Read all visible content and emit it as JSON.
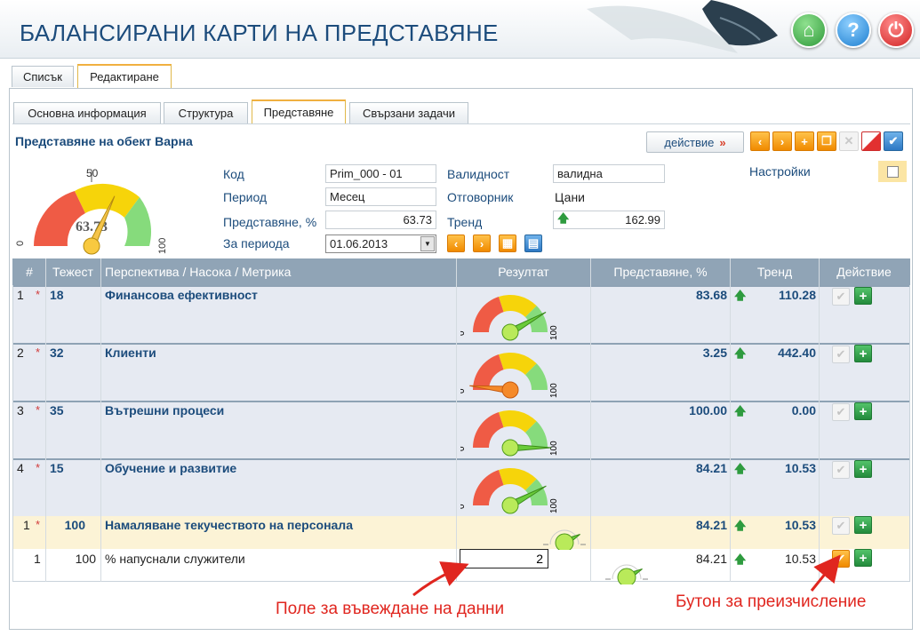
{
  "app": {
    "title": "БАЛАНСИРАНИ КАРТИ НА ПРЕДСТАВЯНЕ"
  },
  "header_buttons": {
    "home": "⌂",
    "help": "?",
    "power": "⏻"
  },
  "main_tabs": [
    {
      "label": "Списък"
    },
    {
      "label": "Редактиране"
    }
  ],
  "sub_tabs": [
    {
      "label": "Основна информация"
    },
    {
      "label": "Структура"
    },
    {
      "label": "Представяне"
    },
    {
      "label": "Свързани задачи"
    }
  ],
  "section": {
    "title": "Представяне на обект Варна"
  },
  "toolbar": {
    "action_label": "действие",
    "action_arrow": "»",
    "icons": {
      "first": "‹",
      "next": "›",
      "add": "+",
      "copy": "❐",
      "close": "✕",
      "check": "✔"
    }
  },
  "gauge_main": {
    "value_label": "63.73",
    "mid_label": "50",
    "min_label": "0",
    "max_label": "100",
    "value": 63.73
  },
  "form": {
    "code_label": "Код",
    "code_value": "Prim_000 - 01",
    "period_label": "Период",
    "period_value": "Месец",
    "perf_label": "Представяне, %",
    "perf_value": "63.73",
    "for_period_label": "За периода",
    "for_period_value": "01.06.2013",
    "validity_label": "Валидност",
    "validity_value": "валидна",
    "owner_label": "Отговорник",
    "owner_value": "Цани",
    "trend_label": "Тренд",
    "trend_value": "162.99",
    "trend_arrow": "🡅",
    "settings_label": "Настройки",
    "period_nav": {
      "prev": "‹",
      "next": "›",
      "cal": "▦",
      "calc": "▤"
    }
  },
  "table": {
    "headers": [
      "#",
      "Тежест",
      "Перспектива / Насока / Метрика",
      "Резултат",
      "Представяне, %",
      "Тренд",
      "Действие"
    ],
    "rows": [
      {
        "no": "1",
        "star": "*",
        "weight": "18",
        "name": "Финансова ефективност",
        "perf": "83.68",
        "trend": "110.28",
        "gauge": 83.68
      },
      {
        "no": "2",
        "star": "*",
        "weight": "32",
        "name": "Клиенти",
        "perf": "3.25",
        "trend": "442.40",
        "gauge": 3.25
      },
      {
        "no": "3",
        "star": "*",
        "weight": "35",
        "name": "Вътрешни процеси",
        "perf": "100.00",
        "trend": "0.00",
        "gauge": 100
      },
      {
        "no": "4",
        "star": "*",
        "weight": "15",
        "name": "Обучение и развитие",
        "perf": "84.21",
        "trend": "10.53",
        "gauge": 84.21
      }
    ],
    "sub_row": {
      "no": "1",
      "star": "*",
      "weight": "100",
      "name": "Намаляване текучеството на персонала",
      "perf": "84.21",
      "trend": "10.53"
    },
    "metric_row": {
      "no": "1",
      "weight": "100",
      "name": "% напуснали служители",
      "input_value": "2",
      "perf": "84.21",
      "trend": "10.53"
    },
    "gauge_min": "0",
    "gauge_max": "100",
    "arrow_up": "🡅",
    "check": "✔",
    "plus": "+"
  },
  "annotations": {
    "input_field": "Поле за въвеждане на данни",
    "recalc_button": "Бутон за преизчисление"
  },
  "colors": {
    "brand_blue": "#1c4c7c",
    "header_row": "#90a4b6",
    "accent_orange": "#f08a00",
    "annotation_red": "#e0261f"
  }
}
